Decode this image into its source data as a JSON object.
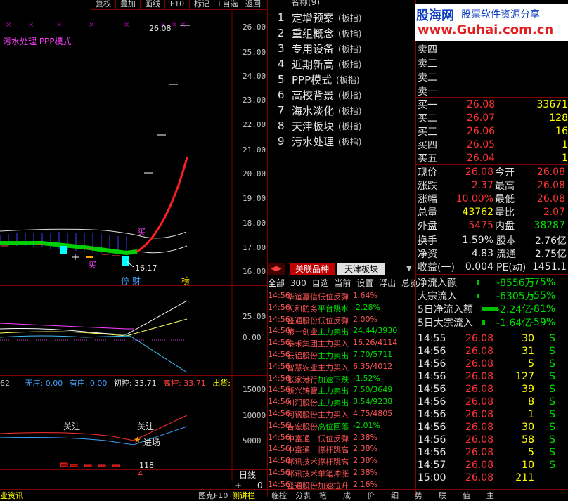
{
  "toolbar": {
    "items": [
      "复权",
      "叠加",
      "画线",
      "F10",
      "标记",
      "+自选",
      "返回"
    ]
  },
  "chart": {
    "title": "污水处理 PPP模式",
    "price_high_label": "26.08",
    "price_low_label": "16.17",
    "price_axis": [
      "26.00",
      "25.00",
      "24.00",
      "23.00",
      "22.00",
      "21.00",
      "20.00",
      "19.00",
      "18.00",
      "17.00",
      "16.00"
    ],
    "buy_label_1": "买",
    "buy_label_2": "买",
    "markers": [
      "停",
      "财",
      "榜"
    ],
    "ind1_axis": [
      "25.00",
      "0.00"
    ],
    "ind2_header": {
      "prefix": "62",
      "no_control": "无庄: 0.00",
      "has_control": "有庄: 0.00",
      "initial": "初控: 33.71",
      "high": "高控: 33.71",
      "out": "出货:"
    },
    "ind2_axis": [
      "15000",
      "10000",
      "5000"
    ],
    "attention_1": "关注",
    "attention_2": "关注",
    "enter_label": "进场",
    "vol_label": "118",
    "bottom_mark": "4",
    "period": "日线",
    "zoom": [
      "+",
      "-",
      "0"
    ]
  },
  "concepts": {
    "header": "名称(9)",
    "items": [
      {
        "num": "1",
        "name": "定增预案",
        "tag": "(板指)"
      },
      {
        "num": "2",
        "name": "重组概念",
        "tag": "(板指)"
      },
      {
        "num": "3",
        "name": "专用设备",
        "tag": "(板指)"
      },
      {
        "num": "4",
        "name": "近期新高",
        "tag": "(板指)"
      },
      {
        "num": "5",
        "name": "PPP模式",
        "tag": "(板指)"
      },
      {
        "num": "6",
        "name": "高校背景",
        "tag": "(板指)"
      },
      {
        "num": "7",
        "name": "海水淡化",
        "tag": "(板指)"
      },
      {
        "num": "8",
        "name": "天津板块",
        "tag": "(板指)"
      },
      {
        "num": "9",
        "name": "污水处理",
        "tag": "(板指)"
      }
    ]
  },
  "tabs": {
    "active": "关联品种",
    "other": "天津板块"
  },
  "filters": [
    "全部",
    "300",
    "自选",
    "当前",
    "设置",
    "浮出",
    "总览"
  ],
  "radar": [
    {
      "t": "14:56",
      "n": "华谊嘉信",
      "a": "低位反弹",
      "v": "1.64%",
      "c": "up"
    },
    {
      "t": "14:56",
      "n": "天和防务",
      "a": "平台跳水",
      "v": "-2.28%",
      "c": "dn"
    },
    {
      "t": "14:56",
      "n": "盛通股份",
      "a": "低位反弹",
      "v": "2.00%",
      "c": "up"
    },
    {
      "t": "14:56",
      "n": "第一创业",
      "a": "主力卖出",
      "v": "24.44/3930",
      "c": "dn"
    },
    {
      "t": "14:56",
      "n": "泰禾集团",
      "a": "主力买入",
      "v": "16.26/4114",
      "c": "up"
    },
    {
      "t": "14:56",
      "n": "云铝股份",
      "a": "主力卖出",
      "v": "7.70/5711",
      "c": "dn"
    },
    {
      "t": "14:56",
      "n": "智慧农业",
      "a": "主力买入",
      "v": "6.35/4012",
      "c": "up"
    },
    {
      "t": "14:56",
      "n": "张家港行",
      "a": "加速下跌",
      "v": "-1.52%",
      "c": "dn"
    },
    {
      "t": "14:56",
      "n": "新兴铸管",
      "a": "主力卖出",
      "v": "7.50/3649",
      "c": "dn"
    },
    {
      "t": "14:56",
      "n": "川润股份",
      "a": "主力卖出",
      "v": "8.54/9238",
      "c": "dn"
    },
    {
      "t": "14:56",
      "n": "河钢股份",
      "a": "主力买入",
      "v": "4.75/4805",
      "c": "up"
    },
    {
      "t": "14:56",
      "n": "吉宏股份",
      "a": "高位回落",
      "v": "-2.01%",
      "c": "dn"
    },
    {
      "t": "14:56",
      "n": "中富通",
      "a": "低位反弹",
      "v": "2.38%",
      "c": "up"
    },
    {
      "t": "14:56",
      "n": "中富通",
      "a": "撑杆跳高",
      "v": "2.38%",
      "c": "up"
    },
    {
      "t": "14:56",
      "n": "邦讯技术",
      "a": "撑杆跳高",
      "v": "2.38%",
      "c": "up"
    },
    {
      "t": "14:56",
      "n": "邦讯技术",
      "a": "单笔冲涨",
      "v": "2.38%",
      "c": "up"
    },
    {
      "t": "14:56",
      "n": "盛通股份",
      "a": "加速拉升",
      "v": "2.16%",
      "c": "up"
    }
  ],
  "quote": {
    "sells": [
      {
        "label": "卖四"
      },
      {
        "label": "卖三"
      },
      {
        "label": "卖二"
      },
      {
        "label": "卖一"
      }
    ],
    "buys": [
      {
        "label": "买一",
        "price": "26.08",
        "vol": "33671"
      },
      {
        "label": "买二",
        "price": "26.07",
        "vol": "128"
      },
      {
        "label": "买三",
        "price": "26.06",
        "vol": "16"
      },
      {
        "label": "买四",
        "price": "26.05",
        "vol": "1"
      },
      {
        "label": "买五",
        "price": "26.04",
        "vol": "1"
      }
    ],
    "stats": [
      {
        "l1": "现价",
        "v1": "26.08",
        "l2": "今开",
        "v2": "26.08"
      },
      {
        "l1": "涨跌",
        "v1": "2.37",
        "l2": "最高",
        "v2": "26.08"
      },
      {
        "l1": "涨幅",
        "v1": "10.00%",
        "l2": "最低",
        "v2": "26.08"
      },
      {
        "l1": "总量",
        "v1": "43762",
        "l2": "量比",
        "v2": "2.07"
      },
      {
        "l1": "外盘",
        "v1": "5475",
        "l2": "内盘",
        "v2": "38287"
      }
    ],
    "stats2": [
      {
        "l1": "换手",
        "v1": "1.59%",
        "l2": "股本",
        "v2": "2.76亿"
      },
      {
        "l1": "净资",
        "v1": "4.83",
        "l2": "流通",
        "v2": "2.75亿"
      },
      {
        "l1": "收益(一)",
        "v1": "0.004",
        "l2": "PE(动)",
        "v2": "1451.1"
      }
    ],
    "flows": [
      {
        "label": "净流入额",
        "value": "-8556万",
        "pct": "-75%"
      },
      {
        "label": "大宗流入",
        "value": "-6305万",
        "pct": "-55%"
      },
      {
        "label": "5日净流入额",
        "value": "-2.24亿",
        "pct": "-81%"
      },
      {
        "label": "5日大宗流入",
        "value": "-1.64亿",
        "pct": "-59%"
      }
    ],
    "ticks": [
      {
        "t": "14:55",
        "p": "26.08",
        "v": "30",
        "s": "S"
      },
      {
        "t": "14:56",
        "p": "26.08",
        "v": "31",
        "s": "S"
      },
      {
        "t": "14:56",
        "p": "26.08",
        "v": "5",
        "s": "S"
      },
      {
        "t": "14:56",
        "p": "26.08",
        "v": "127",
        "s": "S"
      },
      {
        "t": "14:56",
        "p": "26.08",
        "v": "39",
        "s": "S"
      },
      {
        "t": "14:56",
        "p": "26.08",
        "v": "8",
        "s": "S"
      },
      {
        "t": "14:56",
        "p": "26.08",
        "v": "1",
        "s": "S"
      },
      {
        "t": "14:56",
        "p": "26.08",
        "v": "30",
        "s": "S"
      },
      {
        "t": "14:56",
        "p": "26.08",
        "v": "58",
        "s": "S"
      },
      {
        "t": "14:56",
        "p": "26.08",
        "v": "5",
        "s": "S"
      },
      {
        "t": "14:57",
        "p": "26.08",
        "v": "10",
        "s": "S"
      },
      {
        "t": "15:00",
        "p": "26.08",
        "v": "211",
        "s": ""
      }
    ]
  },
  "watermark": {
    "brand": "股海网",
    "slogan": "股票软件资源分享",
    "url": "www.Guhai.com.cn"
  },
  "bottom": {
    "left": "业资讯",
    "mid": "图克F10",
    "mid2": "侧讲栏",
    "tabs": [
      "临控",
      "分表",
      "笔",
      "成",
      "价",
      "细",
      "势",
      "联",
      "值",
      "主"
    ]
  },
  "colors": {
    "up": "#ff3333",
    "down": "#00e000",
    "grid": "#800000",
    "yellow": "#ffff00"
  }
}
